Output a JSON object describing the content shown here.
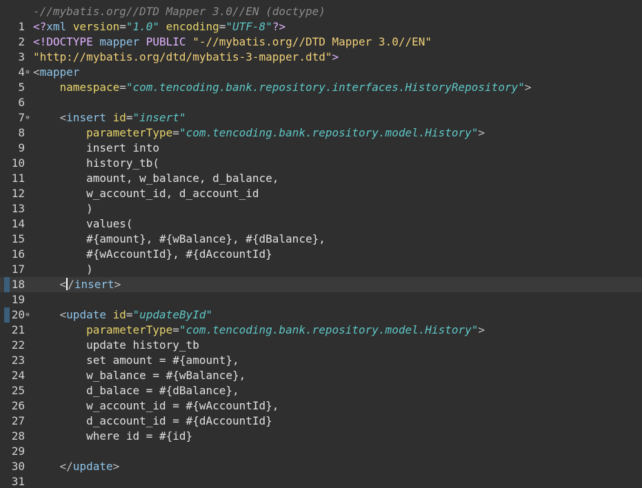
{
  "editor": {
    "doctype_hint": "-//mybatis.org//DTD Mapper 3.0//EN (doctype)",
    "current_line": 18,
    "lines": [
      {
        "num": "1",
        "fold": "",
        "indent": "",
        "segments": [
          {
            "cls": "pi",
            "text": "<?"
          },
          {
            "cls": "tag",
            "text": "xml "
          },
          {
            "cls": "attr",
            "text": "version"
          },
          {
            "cls": "eq",
            "text": "="
          },
          {
            "cls": "val",
            "text": "\"1.0\""
          },
          {
            "cls": "attr",
            "text": " encoding"
          },
          {
            "cls": "eq",
            "text": "="
          },
          {
            "cls": "val",
            "text": "\"UTF-8\""
          },
          {
            "cls": "pi",
            "text": "?>"
          }
        ]
      },
      {
        "num": "2",
        "fold": "",
        "indent": "",
        "segments": [
          {
            "cls": "pi",
            "text": "<!DOCTYPE "
          },
          {
            "cls": "tag",
            "text": "mapper "
          },
          {
            "cls": "pi",
            "text": "PUBLIC "
          },
          {
            "cls": "dtdstr",
            "text": "\"-//mybatis.org//DTD Mapper 3.0//EN\""
          }
        ]
      },
      {
        "num": "3",
        "fold": "",
        "indent": "",
        "segments": [
          {
            "cls": "dtdstr",
            "text": "\"http://mybatis.org/dtd/mybatis-3-mapper.dtd\""
          },
          {
            "cls": "pi",
            "text": ">"
          }
        ]
      },
      {
        "num": "4",
        "fold": "⊖",
        "indent": "",
        "segments": [
          {
            "cls": "br",
            "text": "<"
          },
          {
            "cls": "tag",
            "text": "mapper"
          }
        ]
      },
      {
        "num": "5",
        "fold": "",
        "indent": "    ",
        "segments": [
          {
            "cls": "attr",
            "text": "namespace"
          },
          {
            "cls": "eq",
            "text": "="
          },
          {
            "cls": "val",
            "text": "\"com.tencoding.bank.repository.interfaces.HistoryRepository\""
          },
          {
            "cls": "br",
            "text": ">"
          }
        ]
      },
      {
        "num": "6",
        "fold": "",
        "indent": "",
        "segments": []
      },
      {
        "num": "7",
        "fold": "⊖",
        "indent": "    ",
        "segments": [
          {
            "cls": "br",
            "text": "<"
          },
          {
            "cls": "tag",
            "text": "insert "
          },
          {
            "cls": "attr",
            "text": "id"
          },
          {
            "cls": "eq",
            "text": "="
          },
          {
            "cls": "val",
            "text": "\"insert\""
          }
        ]
      },
      {
        "num": "8",
        "fold": "",
        "indent": "        ",
        "segments": [
          {
            "cls": "attr",
            "text": "parameterType"
          },
          {
            "cls": "eq",
            "text": "="
          },
          {
            "cls": "val",
            "text": "\"com.tencoding.bank.repository.model.History\""
          },
          {
            "cls": "br",
            "text": ">"
          }
        ]
      },
      {
        "num": "9",
        "fold": "",
        "indent": "        ",
        "segments": [
          {
            "cls": "txt",
            "text": "insert into"
          }
        ]
      },
      {
        "num": "10",
        "fold": "",
        "indent": "        ",
        "segments": [
          {
            "cls": "txt",
            "text": "history_tb("
          }
        ]
      },
      {
        "num": "11",
        "fold": "",
        "indent": "        ",
        "segments": [
          {
            "cls": "txt",
            "text": "amount, w_balance, d_balance,"
          }
        ]
      },
      {
        "num": "12",
        "fold": "",
        "indent": "        ",
        "segments": [
          {
            "cls": "txt",
            "text": "w_account_id, d_account_id"
          }
        ]
      },
      {
        "num": "13",
        "fold": "",
        "indent": "        ",
        "segments": [
          {
            "cls": "txt",
            "text": ")"
          }
        ]
      },
      {
        "num": "14",
        "fold": "",
        "indent": "        ",
        "segments": [
          {
            "cls": "txt",
            "text": "values("
          }
        ]
      },
      {
        "num": "15",
        "fold": "",
        "indent": "        ",
        "segments": [
          {
            "cls": "txt",
            "text": "#{amount}, #{wBalance}, #{dBalance},"
          }
        ]
      },
      {
        "num": "16",
        "fold": "",
        "indent": "        ",
        "segments": [
          {
            "cls": "txt",
            "text": "#{wAccountId}, #{dAccountId}"
          }
        ]
      },
      {
        "num": "17",
        "fold": "",
        "indent": "        ",
        "segments": [
          {
            "cls": "txt",
            "text": ")"
          }
        ]
      },
      {
        "num": "18",
        "fold": "",
        "indent": "    ",
        "segments": [
          {
            "cls": "br",
            "text": "<"
          },
          {
            "cls": "caret",
            "text": ""
          },
          {
            "cls": "br",
            "text": "/"
          },
          {
            "cls": "tag",
            "text": "insert"
          },
          {
            "cls": "br",
            "text": ">"
          }
        ]
      },
      {
        "num": "19",
        "fold": "",
        "indent": "",
        "segments": []
      },
      {
        "num": "20",
        "fold": "⊖",
        "indent": "    ",
        "segments": [
          {
            "cls": "br",
            "text": "<"
          },
          {
            "cls": "tag",
            "text": "update "
          },
          {
            "cls": "attr",
            "text": "id"
          },
          {
            "cls": "eq",
            "text": "="
          },
          {
            "cls": "val",
            "text": "\"updateById\""
          }
        ]
      },
      {
        "num": "21",
        "fold": "",
        "indent": "        ",
        "segments": [
          {
            "cls": "attr",
            "text": "parameterType"
          },
          {
            "cls": "eq",
            "text": "="
          },
          {
            "cls": "val",
            "text": "\"com.tencoding.bank.repository.model.History\""
          },
          {
            "cls": "br",
            "text": ">"
          }
        ]
      },
      {
        "num": "22",
        "fold": "",
        "indent": "        ",
        "segments": [
          {
            "cls": "txt",
            "text": "update history_tb"
          }
        ]
      },
      {
        "num": "23",
        "fold": "",
        "indent": "        ",
        "segments": [
          {
            "cls": "txt",
            "text": "set amount = #{amount},"
          }
        ]
      },
      {
        "num": "24",
        "fold": "",
        "indent": "        ",
        "segments": [
          {
            "cls": "txt",
            "text": "w_balance = #{wBalance},"
          }
        ]
      },
      {
        "num": "25",
        "fold": "",
        "indent": "        ",
        "segments": [
          {
            "cls": "txt",
            "text": "d_balace = #{dBalance},"
          }
        ]
      },
      {
        "num": "26",
        "fold": "",
        "indent": "        ",
        "segments": [
          {
            "cls": "txt",
            "text": "w_account_id = #{wAccountId},"
          }
        ]
      },
      {
        "num": "27",
        "fold": "",
        "indent": "        ",
        "segments": [
          {
            "cls": "txt",
            "text": "d_account_id = #{dAccountId}"
          }
        ]
      },
      {
        "num": "28",
        "fold": "",
        "indent": "        ",
        "segments": [
          {
            "cls": "txt",
            "text": "where id = #{id}"
          }
        ]
      },
      {
        "num": "29",
        "fold": "",
        "indent": "",
        "segments": []
      },
      {
        "num": "30",
        "fold": "",
        "indent": "    ",
        "segments": [
          {
            "cls": "br",
            "text": "</"
          },
          {
            "cls": "tag",
            "text": "update"
          },
          {
            "cls": "br",
            "text": ">"
          }
        ]
      },
      {
        "num": "31",
        "fold": "",
        "indent": "",
        "segments": []
      }
    ]
  },
  "colors": {
    "background": "#2f2f2f",
    "current_line": "#3a3a3a",
    "tag": "#8fc5ea",
    "attribute": "#e8d56b",
    "value": "#5fc7c7",
    "text": "#e2e2e2"
  }
}
